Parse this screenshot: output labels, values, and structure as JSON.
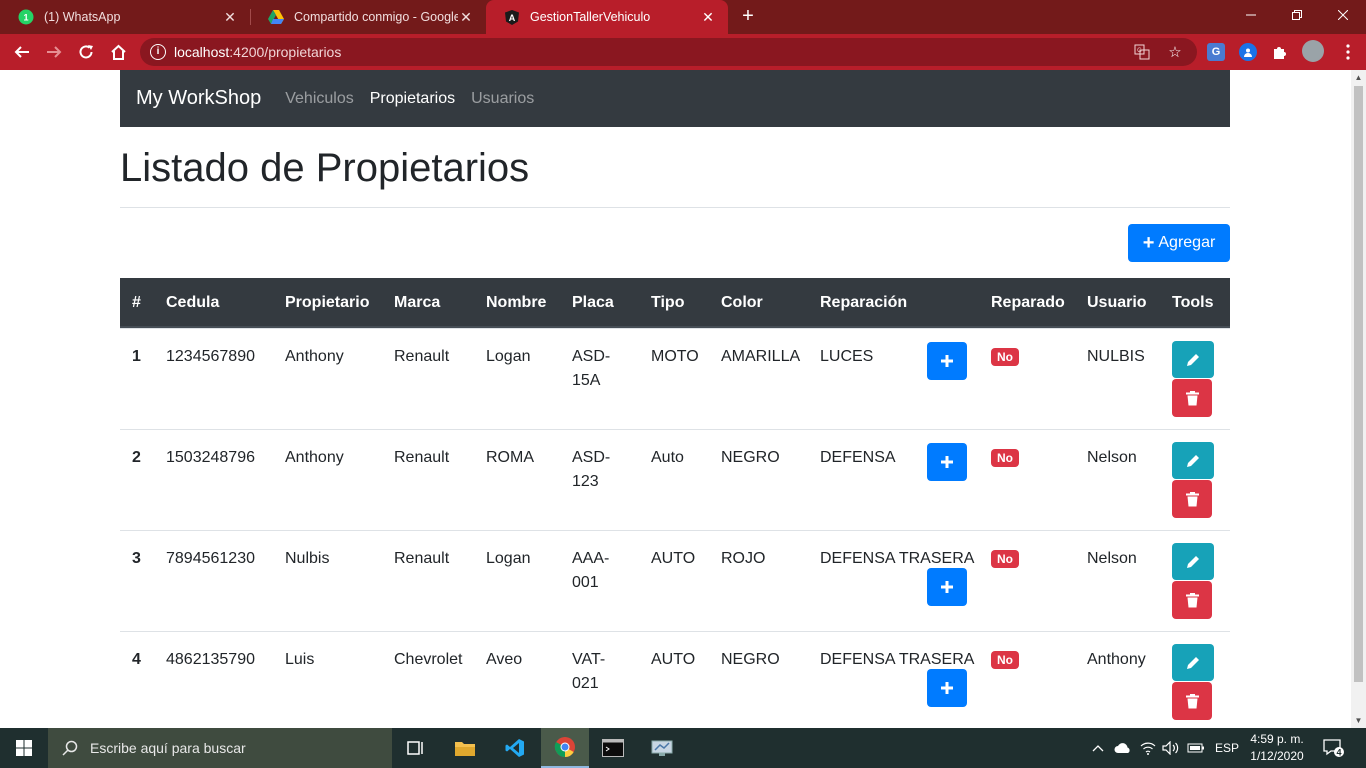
{
  "browser": {
    "tabs": [
      {
        "title": "(1) WhatsApp",
        "icon": "whatsapp-icon",
        "badge": "1"
      },
      {
        "title": "Compartido conmigo - Google D",
        "icon": "google-drive-icon"
      },
      {
        "title": "GestionTallerVehiculo",
        "icon": "angular-icon",
        "active": true
      }
    ],
    "url_host": "localhost",
    "url_rest": ":4200/propietarios",
    "accent": "#b81e2a"
  },
  "navbar": {
    "brand": "My WorkShop",
    "links": [
      "Vehiculos",
      "Propietarios",
      "Usuarios"
    ],
    "active": "Propietarios"
  },
  "page": {
    "title": "Listado de Propietarios",
    "add_button": "Agregar"
  },
  "table": {
    "headers": [
      "#",
      "Cedula",
      "Propietario",
      "Marca",
      "Nombre",
      "Placa",
      "Tipo",
      "Color",
      "Reparación",
      "Reparado",
      "Usuario",
      "Tools"
    ],
    "rows": [
      {
        "num": "1",
        "cedula": "1234567890",
        "propietario": "Anthony",
        "marca": "Renault",
        "nombre": "Logan",
        "placa": "ASD-15A",
        "tipo": "MOTO",
        "color": "AMARILLA",
        "reparacion": "LUCES",
        "reparado": "No",
        "usuario": "NULBIS"
      },
      {
        "num": "2",
        "cedula": "1503248796",
        "propietario": "Anthony",
        "marca": "Renault",
        "nombre": "ROMA",
        "placa": "ASD-123",
        "tipo": "Auto",
        "color": "NEGRO",
        "reparacion": "DEFENSA",
        "reparado": "No",
        "usuario": "Nelson"
      },
      {
        "num": "3",
        "cedula": "7894561230",
        "propietario": "Nulbis",
        "marca": "Renault",
        "nombre": "Logan",
        "placa": "AAA-001",
        "tipo": "AUTO",
        "color": "ROJO",
        "reparacion": "DEFENSA TRASERA",
        "reparado": "No",
        "usuario": "Nelson"
      },
      {
        "num": "4",
        "cedula": "4862135790",
        "propietario": "Luis",
        "marca": "Chevrolet",
        "nombre": "Aveo",
        "placa": "VAT-021",
        "tipo": "AUTO",
        "color": "NEGRO",
        "reparacion": "DEFENSA TRASERA",
        "reparado": "No",
        "usuario": "Anthony"
      }
    ]
  },
  "taskbar": {
    "search_placeholder": "Escribe aquí para buscar",
    "language": "ESP",
    "time": "4:59 p. m.",
    "date": "1/12/2020",
    "notifications": "4"
  }
}
